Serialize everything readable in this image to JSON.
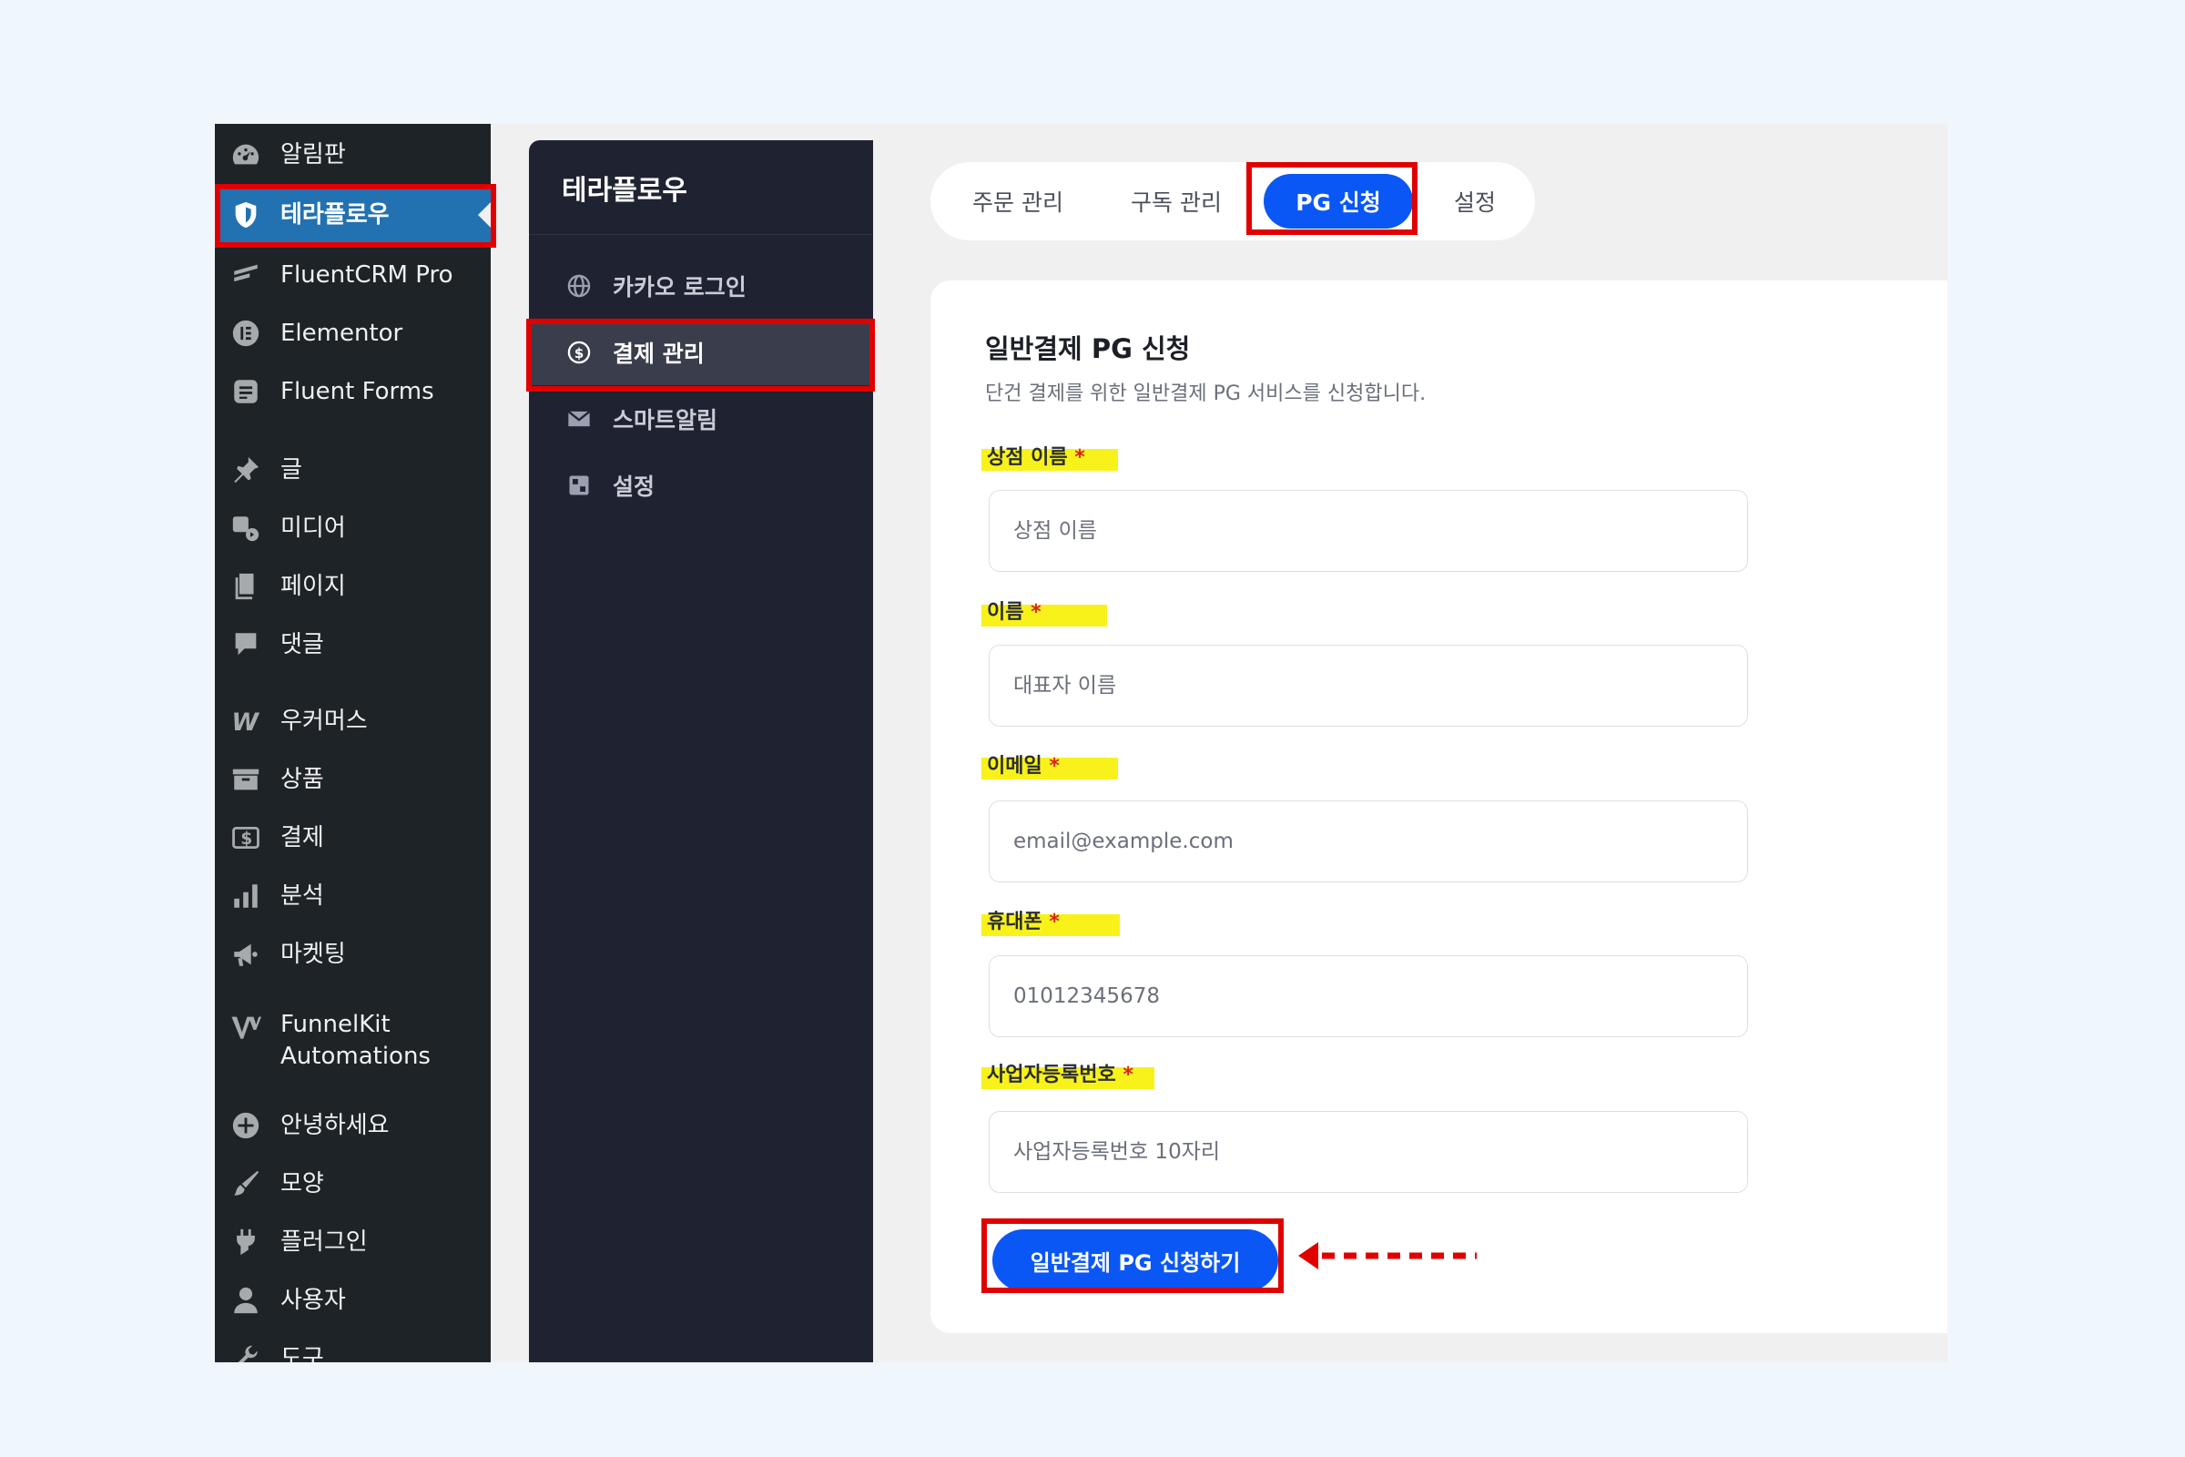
{
  "wp_sidebar": {
    "items": [
      {
        "label": "알림판",
        "icon": "dashboard-gauge-icon"
      },
      {
        "label": "테라플로우",
        "icon": "shield-icon",
        "active": true
      },
      {
        "label": "FluentCRM Pro",
        "icon": "fluentcrm-icon"
      },
      {
        "label": "Elementor",
        "icon": "elementor-icon"
      },
      {
        "label": "Fluent Forms",
        "icon": "fluent-forms-icon"
      },
      {
        "label": "글",
        "icon": "pin-icon"
      },
      {
        "label": "미디어",
        "icon": "media-icon"
      },
      {
        "label": "페이지",
        "icon": "page-icon"
      },
      {
        "label": "댓글",
        "icon": "comment-icon"
      },
      {
        "label": "우커머스",
        "icon": "woocommerce-icon"
      },
      {
        "label": "상품",
        "icon": "archive-box-icon"
      },
      {
        "label": "결제",
        "icon": "dollar-icon"
      },
      {
        "label": "분석",
        "icon": "bar-chart-icon"
      },
      {
        "label": "마켓팅",
        "icon": "megaphone-icon"
      },
      {
        "label": "FunnelKit\nAutomations",
        "icon": "funnelkit-icon"
      },
      {
        "label": "안녕하세요",
        "icon": "plus-circle-icon"
      },
      {
        "label": "모양",
        "icon": "paintbrush-icon"
      },
      {
        "label": "플러그인",
        "icon": "plugin-icon"
      },
      {
        "label": "사용자",
        "icon": "user-icon"
      },
      {
        "label": "도구",
        "icon": "wrench-icon"
      }
    ]
  },
  "plugin_nav": {
    "brand": "테라플로우",
    "items": [
      {
        "label": "카카오 로그인",
        "icon": "globe-icon"
      },
      {
        "label": "결제 관리",
        "icon": "dollar-circle-icon",
        "active": true
      },
      {
        "label": "스마트알림",
        "icon": "mail-icon"
      },
      {
        "label": "설정",
        "icon": "settings-icon"
      }
    ]
  },
  "tabs": [
    "주문 관리",
    "구독 관리",
    "PG 신청",
    "설정"
  ],
  "active_tab": "PG 신청",
  "form": {
    "title": "일반결제 PG 신청",
    "description": "단건 결제를 위한 일반결제 PG 서비스를 신청합니다.",
    "required_mark": "*",
    "fields": [
      {
        "label": "상점 이름",
        "placeholder": "상점 이름"
      },
      {
        "label": "이름",
        "placeholder": "대표자 이름"
      },
      {
        "label": "이메일",
        "placeholder": "email@example.com"
      },
      {
        "label": "휴대폰",
        "placeholder": "01012345678"
      },
      {
        "label": "사업자등록번호",
        "placeholder": "사업자등록번호 10자리"
      }
    ],
    "submit_label": "일반결제 PG 신청하기"
  },
  "colors": {
    "brand_blue": "#0b57f5",
    "wp_active": "#2271b1",
    "annotation_red": "#e00000",
    "highlight_yellow": "#f8f21a"
  }
}
